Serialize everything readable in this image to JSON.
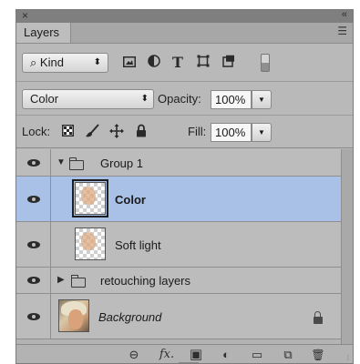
{
  "panel": {
    "tab_label": "Layers",
    "close_glyph": "×",
    "collapse_glyph": "«",
    "menu_glyph": "☰"
  },
  "filter": {
    "kind_label": "Kind",
    "kind_glyph": "⌕",
    "arrows_glyph": "⬍",
    "icons": [
      "pixel-filter-icon",
      "adjustment-filter-icon",
      "type-filter-icon",
      "shape-filter-icon",
      "smart-object-filter-icon"
    ],
    "type_glyph": "T"
  },
  "blend": {
    "mode": "Color",
    "arrows_glyph": "⬍",
    "opacity_label": "Opacity:",
    "opacity_value": "100%",
    "dropdown_glyph": "▼"
  },
  "lock": {
    "label": "Lock:",
    "fill_label": "Fill:",
    "fill_value": "100%",
    "dropdown_glyph": "▼"
  },
  "layers": [
    {
      "name": "Group 1",
      "kind": "group",
      "expanded": true,
      "visible": true
    },
    {
      "name": "Color",
      "kind": "layer",
      "selected": true,
      "visible": true
    },
    {
      "name": "Soft light",
      "kind": "layer",
      "visible": true
    },
    {
      "name": "retouching layers",
      "kind": "group",
      "expanded": false,
      "visible": true
    },
    {
      "name": "Background",
      "kind": "background",
      "locked": true,
      "visible": true
    }
  ],
  "bottom": {
    "link_glyph": "⊖",
    "fx_label": "fx.",
    "mask_glyph": "▣",
    "adjust_glyph": "◐",
    "folder_glyph": "▭",
    "new_glyph": "⧉",
    "trash_glyph": "🗑",
    "grip_glyph": "⁞"
  },
  "colors": {
    "selected_row": "#a9c1e6",
    "panel_bg": "#b9b9b9"
  }
}
